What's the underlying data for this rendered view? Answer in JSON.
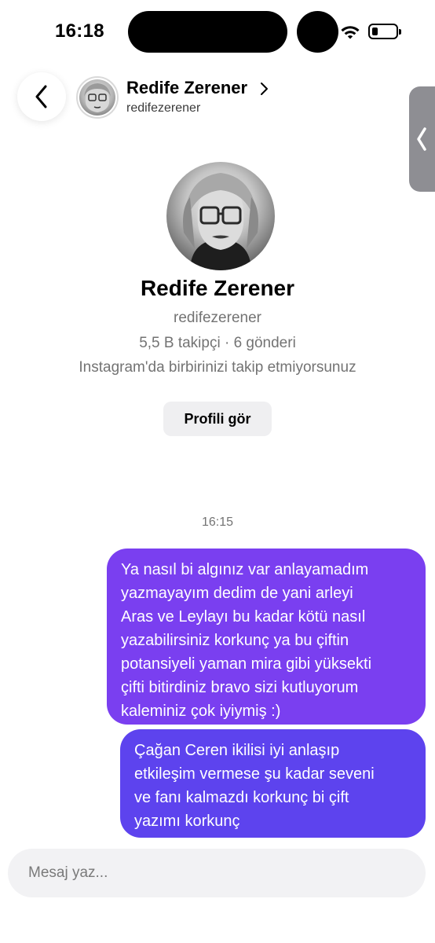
{
  "status_bar": {
    "time": "16:18"
  },
  "header": {
    "name": "Redife Zerener",
    "username": "redifezerener"
  },
  "profile": {
    "name": "Redife Zerener",
    "username": "redifezerener",
    "stats": "5,5 B takipçi · 6 gönderi",
    "follow_note": "Instagram'da birbirinizi takip etmiyorsunuz",
    "view_profile_label": "Profili gör"
  },
  "conversation": {
    "timestamp": "16:15",
    "messages": [
      {
        "lines": [
          "Ya nasıl bi algınız var anlayamadım",
          "yazmayayım dedim de yani arleyi",
          "Aras ve Leylayı bu kadar kötü nasıl",
          "yazabilirsiniz korkunç ya bu çiftin",
          "potansiyeli yaman mira gibi yüksekti",
          "çifti bitirdiniz bravo sizi kutluyorum",
          "kaleminiz çok iyiymiş :)"
        ],
        "color": "#7a3ff0"
      },
      {
        "lines": [
          "Çağan Ceren ikilisi iyi anlaşıp",
          "etkileşim vermese şu kadar seveni",
          "ve fanı kalmazdı korkunç bi çift",
          "yazımı korkunç"
        ],
        "color": "#5d43ee"
      }
    ]
  },
  "composer": {
    "placeholder": "Mesaj yaz..."
  },
  "icons": {
    "back": "chevron-left-icon",
    "header_chevron": "chevron-right-icon",
    "side_handle": "chevron-left-icon",
    "wifi": "wifi-icon",
    "battery": "battery-icon"
  }
}
